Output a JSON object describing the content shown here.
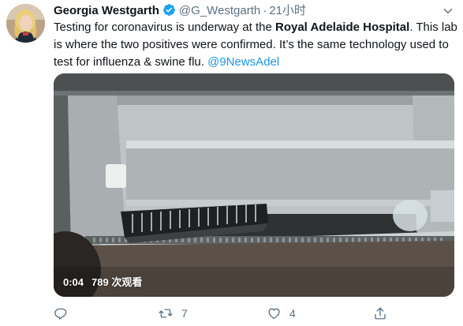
{
  "tweet": {
    "author_name": "Georgia Westgarth",
    "handle": "@G_Westgarth",
    "separator": "·",
    "time": "21小时",
    "text": {
      "part1": "Testing for coronavirus is underway at the ",
      "bold": "Royal Adelaide Hospital",
      "part2": ". This lab is where the two positives were confirmed. It’s the same technology used to test for influenza & swine flu. ",
      "mention": "@9NewsAdel"
    },
    "video": {
      "duration": "0:04",
      "views": "789 次观看"
    },
    "actions": {
      "reply_count": "",
      "retweet_count": "7",
      "like_count": "4"
    }
  },
  "colors": {
    "link": "#1b95e0",
    "verified": "#1da1f2",
    "secondary_text": "#5b7083"
  },
  "icons": [
    "verified-badge-icon",
    "more-icon",
    "reply-icon",
    "retweet-icon",
    "like-icon",
    "share-icon"
  ]
}
